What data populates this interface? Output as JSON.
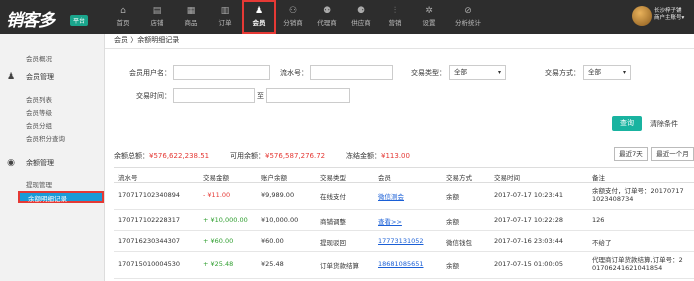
{
  "header": {
    "logo_text": "销客多",
    "logo_badge": "平台",
    "nav": [
      {
        "label": "首页",
        "icon": "home-icon",
        "glyph": "⌂"
      },
      {
        "label": "店铺",
        "icon": "store-icon",
        "glyph": "▤"
      },
      {
        "label": "商品",
        "icon": "goods-icon",
        "glyph": "▦"
      },
      {
        "label": "订单",
        "icon": "order-icon",
        "glyph": "▥"
      },
      {
        "label": "会员",
        "icon": "member-icon",
        "glyph": "♟"
      },
      {
        "label": "分销商",
        "icon": "distributor-icon",
        "glyph": "⚇"
      },
      {
        "label": "代理商",
        "icon": "agent-icon",
        "glyph": "⚉"
      },
      {
        "label": "供应商",
        "icon": "supplier-icon",
        "glyph": "⚈"
      },
      {
        "label": "营销",
        "icon": "marketing-icon",
        "glyph": "⫶"
      },
      {
        "label": "设置",
        "icon": "settings-icon",
        "glyph": "✲"
      },
      {
        "label": "分析统计",
        "icon": "analytics-icon",
        "glyph": "⊘"
      }
    ],
    "user_line1": "长沙梓子铺",
    "user_line2": "商户主账号▾"
  },
  "sidebar": {
    "overview": "会员概况",
    "group1_title": "会员管理",
    "group1_items": [
      "会员列表",
      "会员等级",
      "会员分组",
      "会员积分查询"
    ],
    "group2_title": "余额管理",
    "group2_items": [
      "提现管理",
      "余额明细记录"
    ]
  },
  "breadcrumb": "会员 〉余额明细记录",
  "filters": {
    "member_label": "会员用户名：",
    "serial_label": "流水号：",
    "trade_type_label": "交易类型：",
    "trade_type_value": "全部",
    "trade_method_label": "交易方式：",
    "trade_method_value": "全部",
    "time_label": "交易时间：",
    "to_label": "至",
    "query_button": "查询",
    "clear_button": "清除条件"
  },
  "summary": {
    "total_label": "余额总额：",
    "total_value": "¥576,622,238.51",
    "available_label": "可用余额：",
    "available_value": "¥576,587,276.72",
    "frozen_label": "冻结金额：",
    "frozen_value": "¥113.00",
    "last7": "最近7天",
    "last_month": "最近一个月"
  },
  "table": {
    "headers": [
      "流水号",
      "交易金额",
      "账户余额",
      "交易类型",
      "会员",
      "交易方式",
      "交易时间",
      "备注"
    ],
    "rows": [
      {
        "serial": "170717102340894",
        "amount": "- ¥11.00",
        "amount_color": "red",
        "balance": "¥9,989.00",
        "type": "在线支付",
        "member": "微信测会",
        "method": "余额",
        "time": "2017-07-17 10:23:41",
        "note": "余额支付，订单号：20170717 1023408734"
      },
      {
        "serial": "170717102228317",
        "amount": "+ ¥10,000.00",
        "amount_color": "green",
        "balance": "¥10,000.00",
        "type": "商铺调整",
        "member": "查看>>",
        "method": "余额",
        "time": "2017-07-17 10:22:28",
        "note": "126"
      },
      {
        "serial": "170716230344307",
        "amount": "+ ¥60.00",
        "amount_color": "green",
        "balance": "¥60.00",
        "type": "提现驳回",
        "member": "17773131052",
        "method": "微信钱包",
        "time": "2017-07-16 23:03:44",
        "note": "不给了"
      },
      {
        "serial": "170715010004530",
        "amount": "+ ¥25.48",
        "amount_color": "green",
        "balance": "¥25.48",
        "type": "订单货款结算",
        "member": "18681085651",
        "method": "余额",
        "time": "2017-07-15 01:00:05",
        "note": "代理商订单货款结算,订单号：2 01706241621041854"
      }
    ]
  },
  "colors": {
    "accent": "#1a9bd7",
    "query": "#19b3a0",
    "highlight": "#e53935",
    "topbar": "#2d2d2d"
  }
}
